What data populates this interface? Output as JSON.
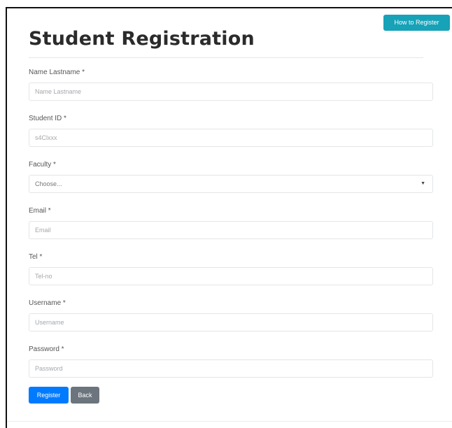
{
  "page": {
    "title": "Student Registration",
    "help_button": "How to Register"
  },
  "form": {
    "fields": [
      {
        "label": "Name Lastname *",
        "placeholder": "Name Lastname",
        "type": "text"
      },
      {
        "label": "Student ID *",
        "placeholder": "s4Clxxx",
        "type": "text"
      },
      {
        "label": "Faculty *",
        "selected": "Choose...",
        "type": "select"
      },
      {
        "label": "Email *",
        "placeholder": "Email",
        "type": "text"
      },
      {
        "label": "Tel *",
        "placeholder": "Tel-no",
        "type": "text"
      },
      {
        "label": "Username *",
        "placeholder": "Username",
        "type": "text"
      },
      {
        "label": "Password *",
        "placeholder": "Password",
        "type": "password"
      }
    ],
    "register_button": "Register",
    "back_button": "Back"
  },
  "colors": {
    "help_button": "#17a2b8",
    "register_button": "#007bff",
    "back_button": "#6c757d"
  }
}
